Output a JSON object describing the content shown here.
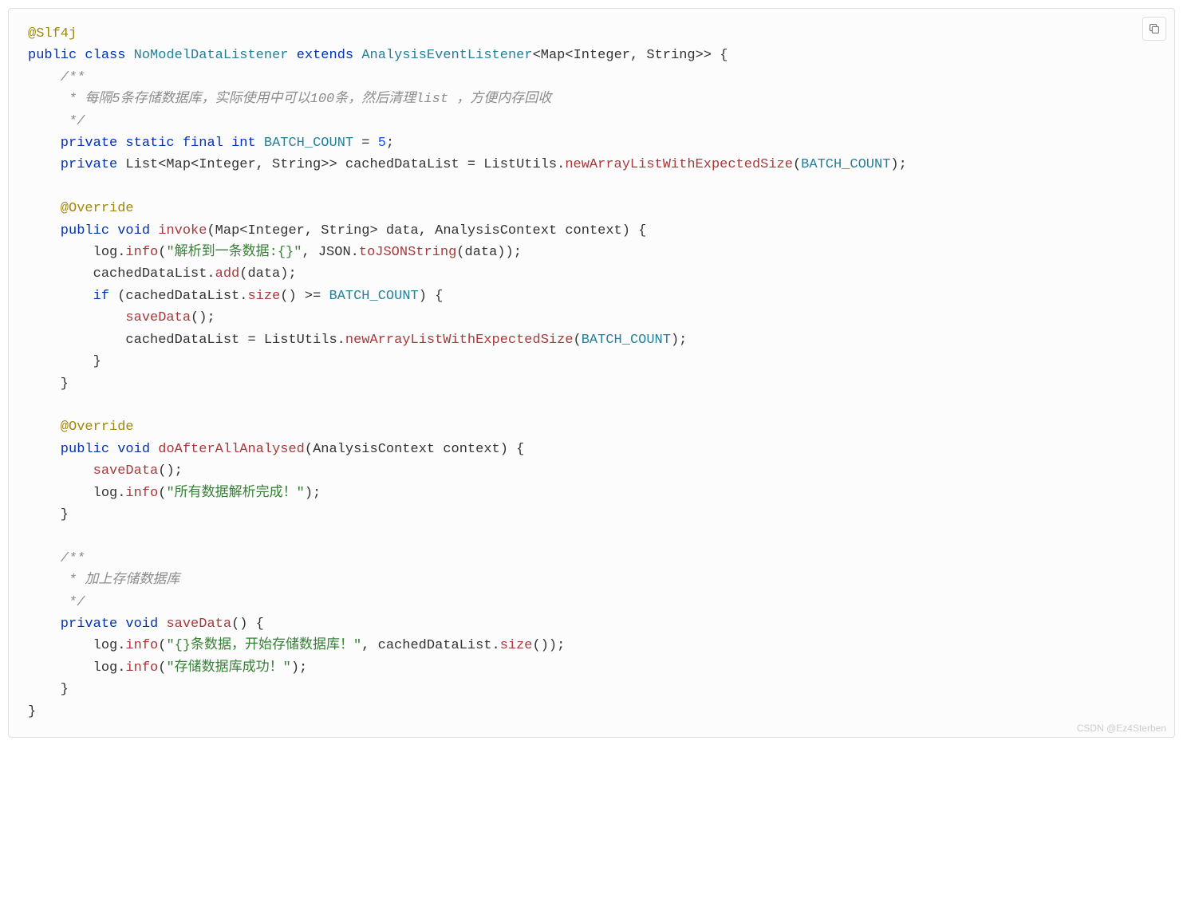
{
  "code": {
    "l1_annotation": "@Slf4j",
    "l2_public": "public",
    "l2_class": "class",
    "l2_name": "NoModelDataListener",
    "l2_extends": "extends",
    "l2_parent": "AnalysisEventListener",
    "l2_gen": "<Map<Integer, String>> {",
    "l3": "    /**",
    "l4": "     * 每隔5条存储数据库，实际使用中可以100条，然后清理list ，方便内存回收",
    "l5": "     */",
    "l6_private": "    private",
    "l6_static": "static",
    "l6_final": "final",
    "l6_int": "int",
    "l6_const": "BATCH_COUNT",
    "l6_eq": " = ",
    "l6_val": "5",
    "l6_semi": ";",
    "l7_private": "    private",
    "l7_list": " List<Map<Integer, String>> cachedDataList = ListUtils.",
    "l7_fn": "newArrayListWithExpectedSize",
    "l7_open": "(",
    "l7_bc": "BATCH_COUNT",
    "l7_close": ");",
    "l9": "    @Override",
    "l10_public": "    public",
    "l10_void": "void",
    "l10_fn": "invoke",
    "l10_args": "(Map<Integer, String> data, AnalysisContext context) {",
    "l11_pre": "        log.",
    "l11_fn": "info",
    "l11_open": "(",
    "l11_str": "\"解析到一条数据:{}\"",
    "l11_mid": ", JSON.",
    "l11_fn2": "toJSONString",
    "l11_end": "(data));",
    "l12_pre": "        cachedDataList.",
    "l12_fn": "add",
    "l12_end": "(data);",
    "l13_pre": "        ",
    "l13_if": "if",
    "l13_open": " (cachedDataList.",
    "l13_fn": "size",
    "l13_mid": "() >= ",
    "l13_bc": "BATCH_COUNT",
    "l13_end": ") {",
    "l14_pre": "            ",
    "l14_fn": "saveData",
    "l14_end": "();",
    "l15_pre": "            cachedDataList = ListUtils.",
    "l15_fn": "newArrayListWithExpectedSize",
    "l15_open": "(",
    "l15_bc": "BATCH_COUNT",
    "l15_end": ");",
    "l16": "        }",
    "l17": "    }",
    "l19": "    @Override",
    "l20_public": "    public",
    "l20_void": "void",
    "l20_fn": "doAfterAllAnalysed",
    "l20_args": "(AnalysisContext context) {",
    "l21_pre": "        ",
    "l21_fn": "saveData",
    "l21_end": "();",
    "l22_pre": "        log.",
    "l22_fn": "info",
    "l22_open": "(",
    "l22_str": "\"所有数据解析完成！\"",
    "l22_end": ");",
    "l23": "    }",
    "l25": "    /**",
    "l26": "     * 加上存储数据库",
    "l27": "     */",
    "l28_private": "    private",
    "l28_void": "void",
    "l28_fn": "saveData",
    "l28_args": "() {",
    "l29_pre": "        log.",
    "l29_fn": "info",
    "l29_open": "(",
    "l29_str": "\"{}条数据，开始存储数据库！\"",
    "l29_mid": ", cachedDataList.",
    "l29_fn2": "size",
    "l29_end": "());",
    "l30_pre": "        log.",
    "l30_fn": "info",
    "l30_open": "(",
    "l30_str": "\"存储数据库成功！\"",
    "l30_end": ");",
    "l31": "    }",
    "l32": "}"
  },
  "watermark": "CSDN @Ez4Sterben"
}
